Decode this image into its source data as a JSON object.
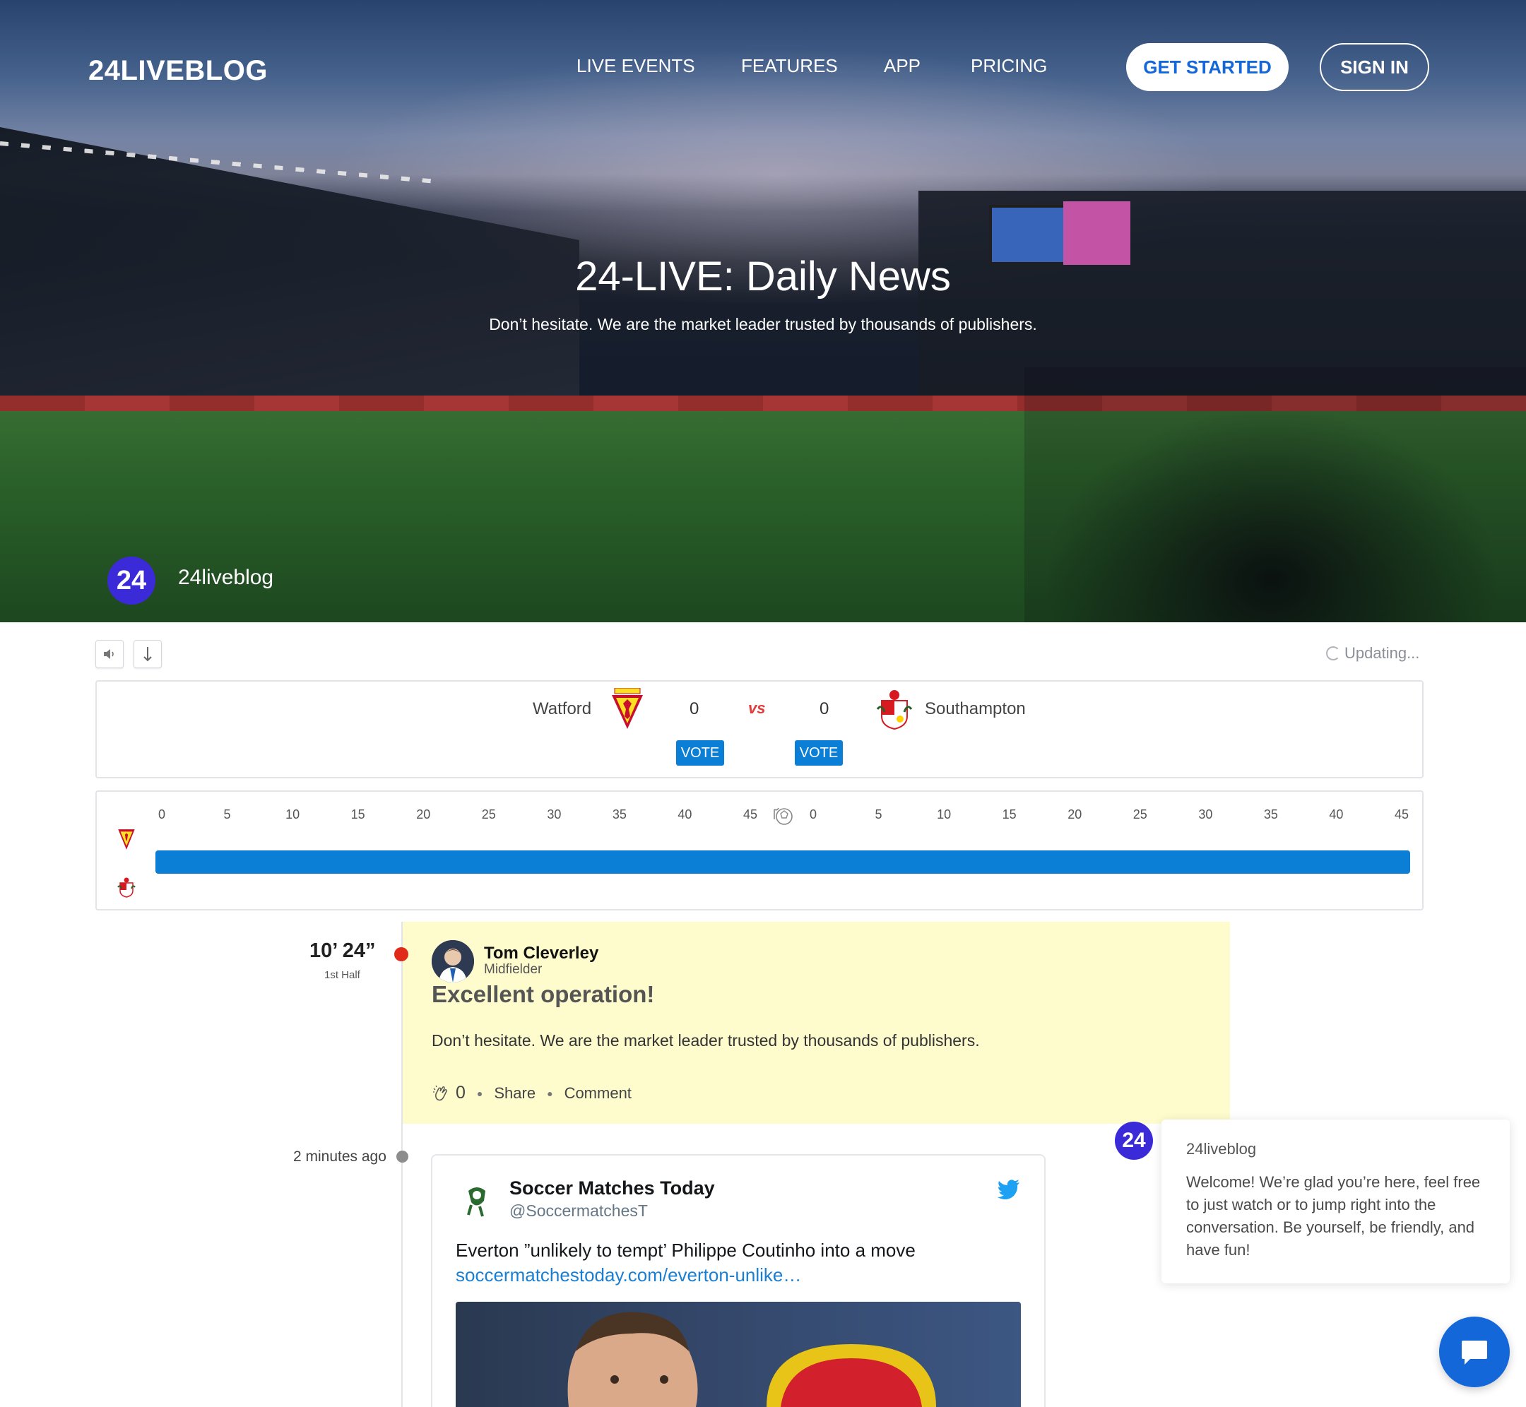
{
  "header": {
    "logo": "24LIVEBLOG",
    "nav": [
      "LIVE EVENTS",
      "FEATURES",
      "APP",
      "PRICING"
    ],
    "get_started": "GET STARTED",
    "sign_in": "SIGN IN"
  },
  "hero": {
    "title": "24-LIVE: Daily News",
    "subtitle": "Don’t hesitate. We are the market leader trusted by thousands of publishers.",
    "avatar_text": "24",
    "brand": "24liveblog"
  },
  "controls": {
    "sound_icon": "speaker-icon",
    "down_icon": "arrow-down-icon",
    "status": "Updating..."
  },
  "match": {
    "home_team": "Watford",
    "away_team": "Southampton",
    "home_score": "0",
    "away_score": "0",
    "vs": "vs",
    "vote_label": "VOTE"
  },
  "timeline": {
    "first_half_ticks": [
      "0",
      "5",
      "10",
      "15",
      "20",
      "25",
      "30",
      "35",
      "40",
      "45"
    ],
    "second_half_ticks": [
      "0",
      "5",
      "10",
      "15",
      "20",
      "25",
      "30",
      "35",
      "40",
      "45"
    ],
    "bar_color": "#0b7ed6"
  },
  "posts": [
    {
      "time": "10’ 24”",
      "period": "1st Half",
      "author": "Tom Cleverley",
      "role": "Midfielder",
      "title": "Excellent operation!",
      "text": "Don’t hesitate. We are the market leader trusted by thousands of publishers.",
      "claps": "0",
      "share": "Share",
      "comment": "Comment",
      "bg_color": "#fefccd"
    },
    {
      "time": "2 minutes ago",
      "tweet": {
        "name": "Soccer Matches Today",
        "handle": "@SoccermatchesT",
        "text": "Everton ”unlikely to tempt’ Philippe Coutinho into a move",
        "link": "soccermatchestoday.com/everton-unlike…"
      }
    }
  ],
  "chat": {
    "avatar_text": "24",
    "name": "24liveblog",
    "message": "Welcome! We’re glad you’re here, feel free to just watch or to jump right into the conversation. Be yourself, be friendly, and have fun!",
    "launcher_icon": "chat-bubble-icon",
    "accent": "#1467d9"
  }
}
